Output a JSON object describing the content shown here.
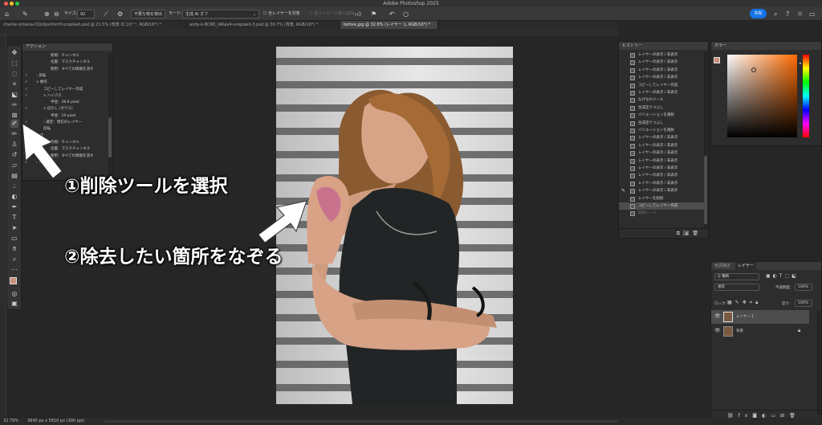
{
  "app": {
    "title": "Adobe Photoshop 2025"
  },
  "options_bar": {
    "size_label": "サイズ:",
    "size_value": "92",
    "btn_remove_distractions": "不要な物を検出",
    "mode_label": "モード:",
    "mode_value": "生成 AI オフ",
    "sample_all_layers": "全レイヤーを対象",
    "remove_after_stroke": "各ストローク後に削除",
    "share": "共有"
  },
  "tabs": [
    {
      "label": "charlie-octavia-O1kXpvhhrnY-unsplash.psd @ 21.5% (背景 のコピー, RGB/16*) *",
      "active": false
    },
    {
      "label": "andy-k-8CR8_rAKav4-unsplash-3.psd @ 30.7% (背景, RGB/16*) *",
      "active": false
    },
    {
      "label": "before.jpg @ 32.8% (レイヤー 1, RGB/16*) *",
      "active": true
    }
  ],
  "actions_panel": {
    "title": "アクション",
    "rows": [
      {
        "check": "",
        "indent": 3,
        "text": "新規：チャンネル"
      },
      {
        "check": "",
        "indent": 3,
        "text": "位置：マスクチャンネル"
      },
      {
        "check": "",
        "indent": 3,
        "text": "使用：すべての情報を消す"
      },
      {
        "check": "✓",
        "indent": 1,
        "text": "› 反転"
      },
      {
        "check": "✓",
        "indent": 1,
        "text": "∨ 複作"
      },
      {
        "check": "✓",
        "indent": 2,
        "text": "コピーしてレイヤー作成"
      },
      {
        "check": "✓",
        "indent": 2,
        "text": "∨ ハイパス"
      },
      {
        "check": "",
        "indent": 3,
        "text": "半径：38.8 pixel"
      },
      {
        "check": "✓",
        "indent": 2,
        "text": "∨ ぼかし (ガウス)"
      },
      {
        "check": "",
        "indent": 3,
        "text": "半径：19 pixel"
      },
      {
        "check": "✓",
        "indent": 2,
        "text": "› 選定：現在のレイヤー"
      },
      {
        "check": "✓",
        "indent": 2,
        "text": "反転"
      },
      {
        "check": "✓",
        "indent": 1,
        "text": "作成"
      },
      {
        "check": "",
        "indent": 3,
        "text": "新規：チャンネル"
      },
      {
        "check": "",
        "indent": 3,
        "text": "位置：マスクチャンネル"
      },
      {
        "check": "",
        "indent": 3,
        "text": "使用：すべての情報を消す"
      },
      {
        "check": "✓",
        "indent": 1,
        "text": "› コピー"
      }
    ]
  },
  "history_panel": {
    "title": "ヒストリー",
    "items": [
      "レイヤーの表示 / 非表示",
      "レイヤーの表示 / 非表示",
      "レイヤーの表示 / 非表示",
      "レイヤーの表示 / 非表示",
      "コピーしてレイヤー作成",
      "レイヤーの表示 / 非表示",
      "なげなわツール",
      "生成塗りつぶし",
      "バリエーションを選択",
      "生成塗りつぶし",
      "バリエーションを選択",
      "レイヤーの表示 / 非表示",
      "レイヤーの表示 / 非表示",
      "レイヤーの表示 / 非表示",
      "レイヤーの表示 / 非表示",
      "レイヤーの表示 / 非表示",
      "レイヤーの表示 / 非表示",
      "レイヤーの表示 / 非表示",
      "レイヤーの表示 / 非表示",
      "レイヤーを削除",
      "コピーしてレイヤー作成",
      "削除ツール"
    ]
  },
  "color_panel": {
    "title": "カラー"
  },
  "layers_panel": {
    "tab_adjust": "色調補正",
    "tab_layers": "レイヤー",
    "kind": "Q 種類",
    "blend": "通常",
    "opacity_label": "不透明度:",
    "opacity_value": "100%",
    "lock_label": "ロック:",
    "fill_label": "塗り:",
    "fill_value": "100%",
    "layers": [
      {
        "name": "レイヤー 1",
        "selected": true
      },
      {
        "name": "背景",
        "selected": false
      }
    ]
  },
  "annotations": {
    "step1": "①削除ツールを選択",
    "step2": "②除去したい箇所をなぞる"
  },
  "status": {
    "zoom": "32.79%",
    "doc_info": "3840 px x 5810 px (300 ppi)"
  },
  "colors": {
    "accent": "#1473e6",
    "foreground_swatch": "#c9907a",
    "background_swatch": "#1a1a1a"
  }
}
